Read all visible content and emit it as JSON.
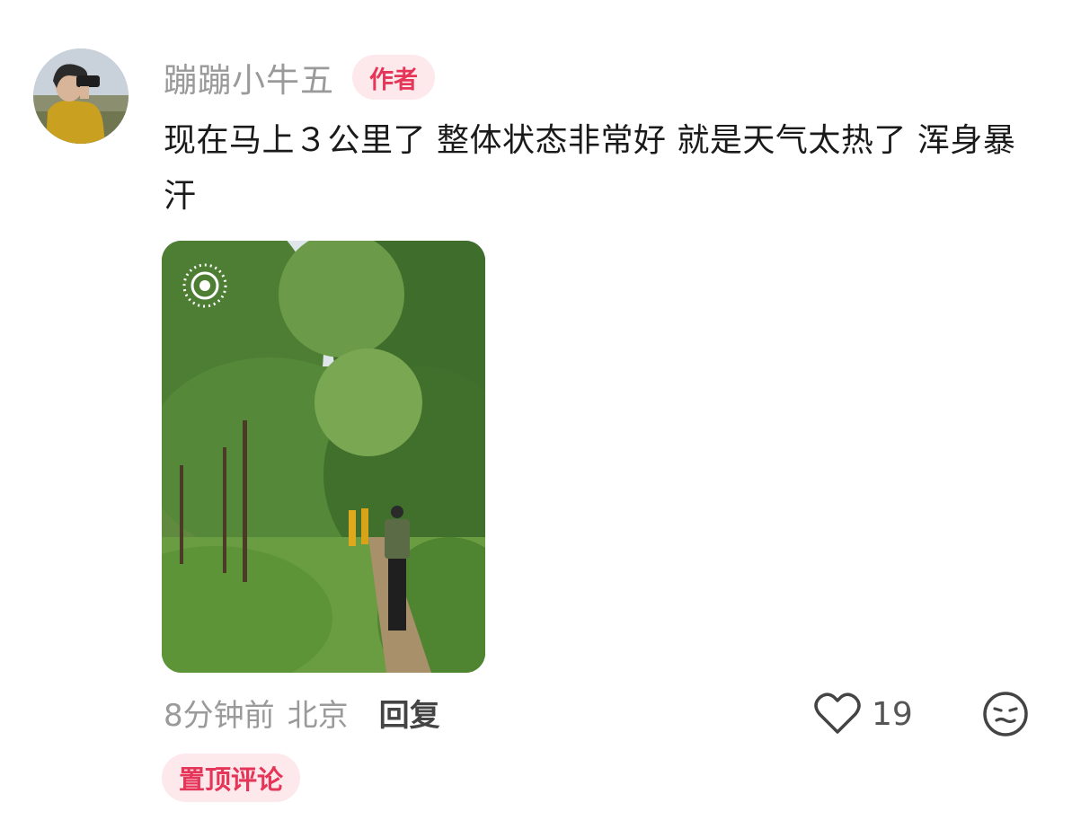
{
  "comment": {
    "username": "蹦蹦小牛五",
    "author_badge": "作者",
    "text": "现在马上３公里了 整体状态非常好 就是天气太热了 浑身暴汗",
    "time": "8分钟前",
    "location": "北京",
    "reply_label": "回复",
    "like_count": "19",
    "pinned_label": "置顶评论"
  },
  "icons": {
    "avatar": "avatar-photo",
    "live_photo": "live-photo-icon",
    "like": "heart-icon",
    "emoji": "emoji-face-icon"
  },
  "colors": {
    "accent_pink": "#e53558",
    "badge_bg": "#fde8ec",
    "muted_text": "#9a9a9a"
  }
}
